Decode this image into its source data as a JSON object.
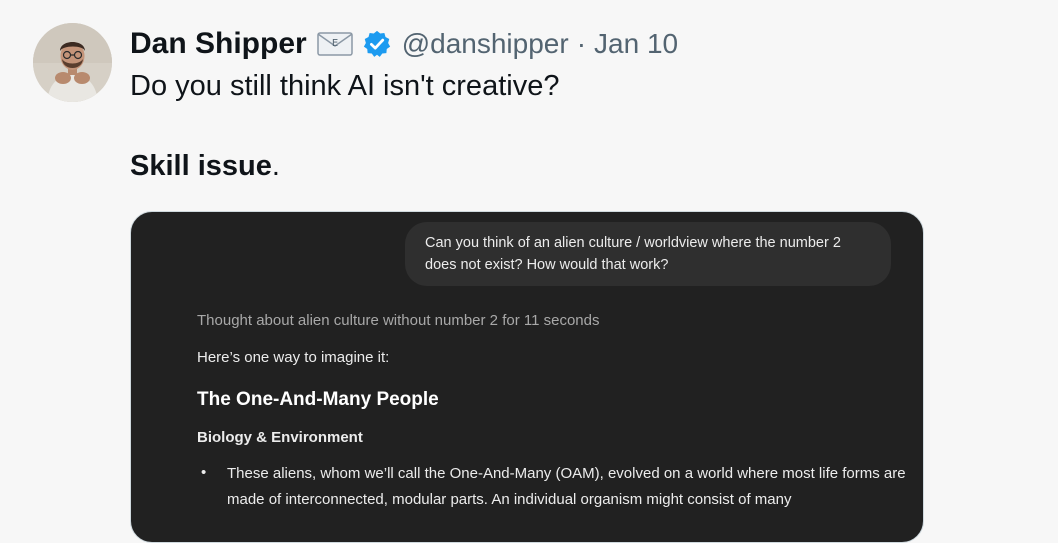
{
  "author": {
    "name": "Dan Shipper",
    "envelope_icon": "envelope-icon",
    "envelope_letter": "E",
    "verified_icon": "verified-badge-icon",
    "handle": "@danshipper",
    "separator": "·",
    "date": "Jan 10"
  },
  "tweet": {
    "line1": "Do you still think AI isn't creative?",
    "line2_bold": "Skill issue",
    "line2_suffix": "."
  },
  "media": {
    "user_message": "Can you think of an alien culture / worldview where the number 2 does not exist? How would that work?",
    "thought": "Thought about alien culture without number 2 for 11 seconds",
    "intro": "Here’s one way to imagine it:",
    "heading": "The One-And-Many People",
    "subheading": "Biology & Environment",
    "bullet_marker": "•",
    "bullet_text": "These aliens, whom we’ll call the One-And-Many (OAM), evolved on a world where most life forms are made of interconnected, modular parts. An individual organism might consist of many"
  },
  "colors": {
    "background": "#f7f7f7",
    "verified_blue": "#1d9bf0",
    "secondary_text": "#536471",
    "media_background": "#212121",
    "bubble_background": "#2f2f2f"
  }
}
